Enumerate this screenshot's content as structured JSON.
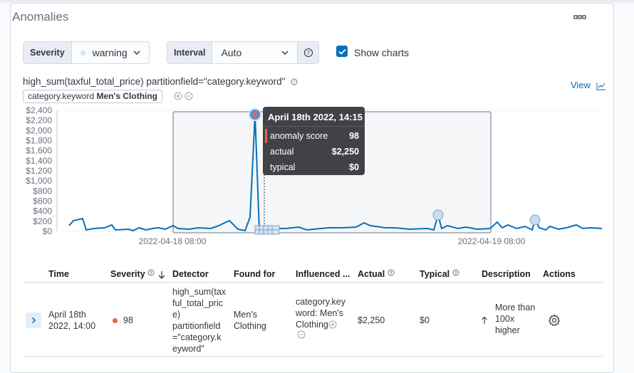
{
  "panel": {
    "title": "Anomalies",
    "more_icon": "ellipsis-icon"
  },
  "controls": {
    "severity_label": "Severity",
    "severity_value": "warning",
    "interval_label": "Interval",
    "interval_value": "Auto",
    "show_charts_label": "Show charts",
    "show_charts_checked": true
  },
  "chart": {
    "title": "high_sum(taxful_total_price) partitionfield=\"category.keyword\"",
    "badge_field": "category.keyword",
    "badge_value": "Men's Clothing",
    "view_label": "View",
    "y_ticks": [
      "$2,400",
      "$2,200",
      "$2,000",
      "$1,800",
      "$1,600",
      "$1,400",
      "$1,200",
      "$1,000",
      "$800",
      "$600",
      "$400",
      "$200",
      "$0"
    ],
    "x_ticks": [
      "2022-04-18 08:00",
      "2022-04-19 08:00"
    ],
    "accent": "#006bb8",
    "anomaly_color": "#e7664c"
  },
  "tooltip": {
    "title": "April 18th 2022, 14:15",
    "rows": [
      {
        "label": "anomaly score",
        "value": "98"
      },
      {
        "label": "actual",
        "value": "$2,250"
      },
      {
        "label": "typical",
        "value": "$0"
      }
    ]
  },
  "table": {
    "headers": {
      "time": "Time",
      "severity": "Severity",
      "detector": "Detector",
      "found_for": "Found for",
      "influenced": "Influenced ...",
      "actual": "Actual",
      "typical": "Typical",
      "description": "Description",
      "actions": "Actions"
    },
    "row": {
      "time_line1": "April 18th",
      "time_line2": "2022, 14:00",
      "severity": "98",
      "detector_lines": [
        "high_sum(tax",
        "ful_total_pric",
        "e)",
        "partitionfield",
        "=\"category.k",
        "eyword\""
      ],
      "found_for_lines": [
        "Men's",
        "Clothing"
      ],
      "influenced_lines": [
        "category.key",
        "word: Men's",
        "Clothing"
      ],
      "actual": "$2,250",
      "typical": "$0",
      "description_lines": [
        "More than",
        "100x",
        "higher"
      ]
    }
  }
}
